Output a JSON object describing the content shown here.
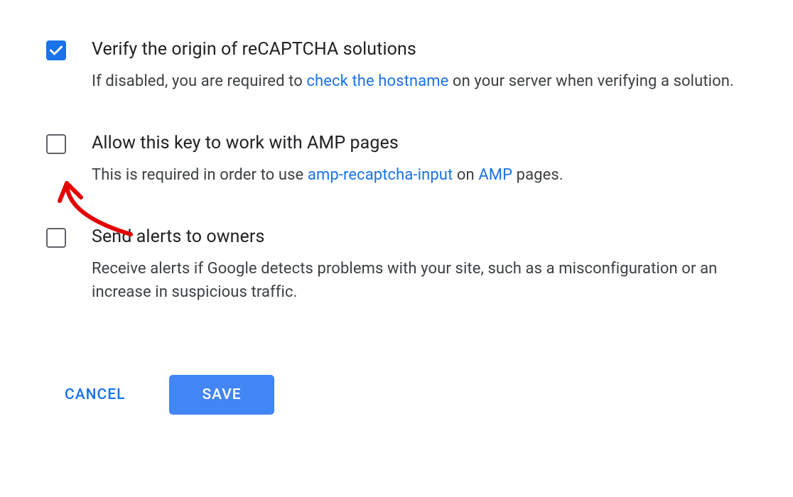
{
  "options": [
    {
      "title": "Verify the origin of reCAPTCHA solutions",
      "desc_pre": "If disabled, you are required to ",
      "link": "check the hostname",
      "desc_post": " on your server when verifying a solution.",
      "checked": true
    },
    {
      "title": "Allow this key to work with AMP pages",
      "desc_pre": "This is required in order to use ",
      "link": "amp-recaptcha-input",
      "desc_mid": " on ",
      "link2": "AMP",
      "desc_post": " pages.",
      "checked": false
    },
    {
      "title": "Send alerts to owners",
      "desc_pre": "Receive alerts if Google detects problems with your site, such as a misconfiguration or an increase in suspicious traffic.",
      "checked": false
    }
  ],
  "buttons": {
    "cancel": "CANCEL",
    "save": "SAVE"
  }
}
